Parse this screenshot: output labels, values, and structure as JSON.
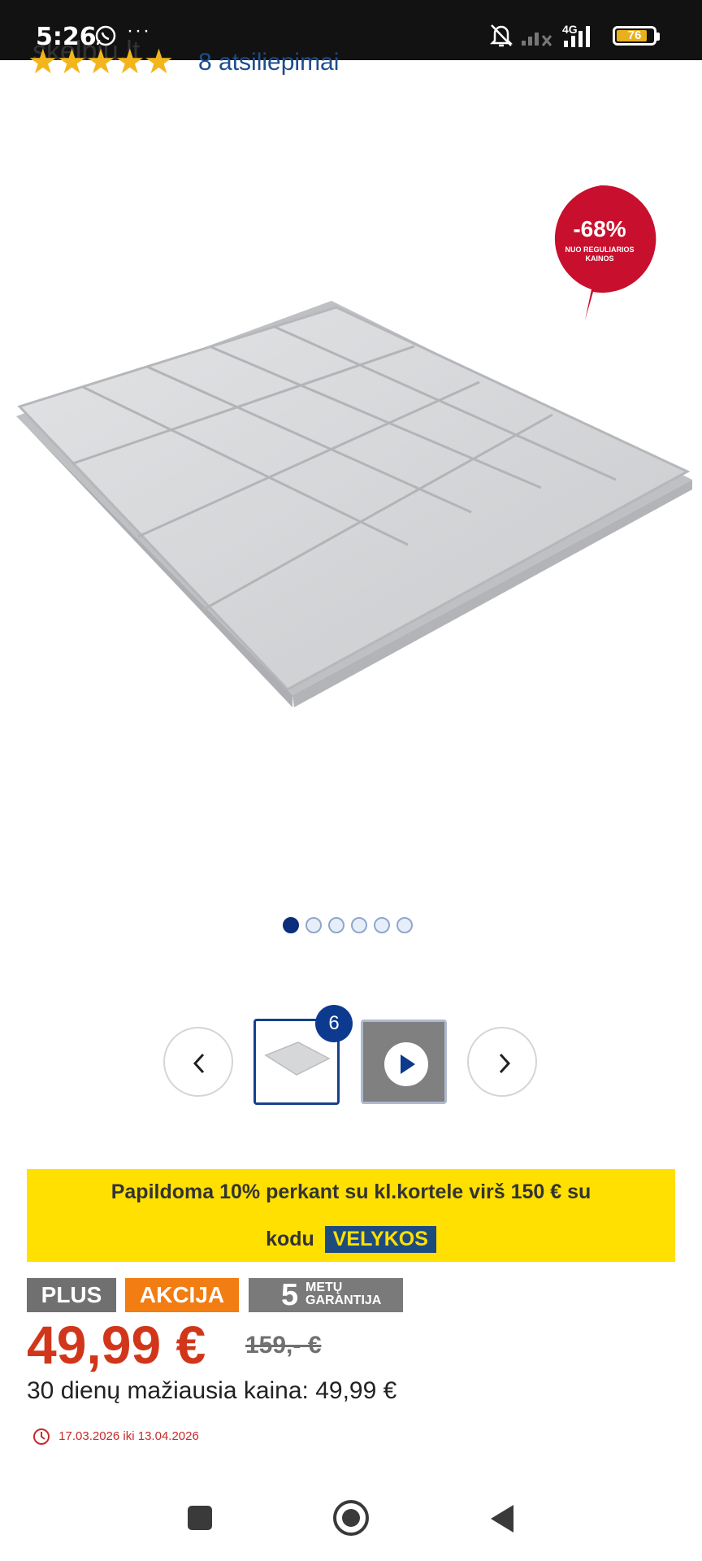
{
  "status_bar": {
    "time": "5:26",
    "more": "···",
    "ghost_text": "skelbiu.lt",
    "network": "4G",
    "battery": "76"
  },
  "reviews": {
    "stars": "★★★★★",
    "count_text": "8 atsiliepimai"
  },
  "discount_badge": {
    "percent": "-68%",
    "note": "NUO REGULIARIOS KAINOS"
  },
  "gallery": {
    "image_count": "6",
    "dots": 6,
    "active_dot": 0
  },
  "promo": {
    "line1": "Papildoma 10% perkant su kl.kortele virš 150 € su",
    "line2_prefix": "kodu",
    "code": "VELYKOS"
  },
  "tags": {
    "plus": "PLUS",
    "akcija": "AKCIJA",
    "warranty_number": "5",
    "warranty_line1": "METŲ",
    "warranty_line2": "GARANTIJA"
  },
  "price": {
    "current": "49,99 €",
    "old": "159,- €",
    "lowest_30_days": "30 dienų mažiausia kaina: 49,99 €",
    "valid_dates": "17.03.2026 iki 13.04.2026"
  },
  "colors": {
    "price_red": "#d1361b",
    "promo_yellow": "#ffe000",
    "brand_blue": "#0b3a8f",
    "akcija_orange": "#f27d12",
    "badge_red": "#c8102e"
  }
}
